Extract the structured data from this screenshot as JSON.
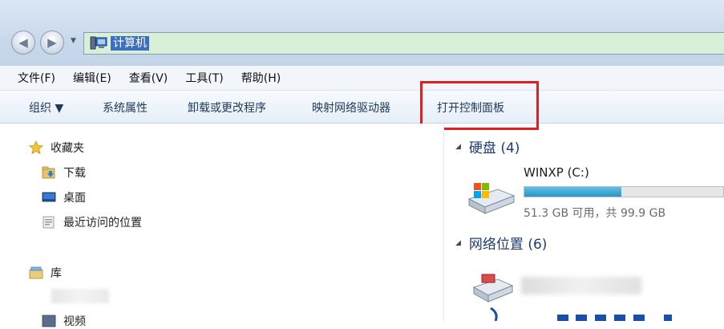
{
  "address_bar": {
    "back_glyph": "◀",
    "forward_glyph": "▶",
    "dropdown_glyph": "▼",
    "location_icon": "computer-icon",
    "location_text": "计算机"
  },
  "menu": {
    "items": [
      {
        "label": "文件(F)"
      },
      {
        "label": "编辑(E)"
      },
      {
        "label": "查看(V)"
      },
      {
        "label": "工具(T)"
      },
      {
        "label": "帮助(H)"
      }
    ]
  },
  "toolbar": {
    "organize": "组织 ▼",
    "system_properties": "系统属性",
    "uninstall_programs": "卸载或更改程序",
    "map_network_drive": "映射网络驱动器",
    "open_control_panel": "打开控制面板",
    "highlight_color": "#e0201f"
  },
  "nav_pane": {
    "favorites": "收藏夹",
    "downloads": "下载",
    "desktop": "桌面",
    "recent_places": "最近访问的位置",
    "libraries": "库",
    "videos": "视频"
  },
  "content": {
    "hard_disks_header": "硬盘 (4)",
    "drive": {
      "name": "WINXP (C:)",
      "used_fraction": 0.486,
      "space_text": "51.3 GB 可用，共 99.9 GB",
      "bar_color": "#2a95c8"
    },
    "network_header": "网络位置 (6)"
  }
}
